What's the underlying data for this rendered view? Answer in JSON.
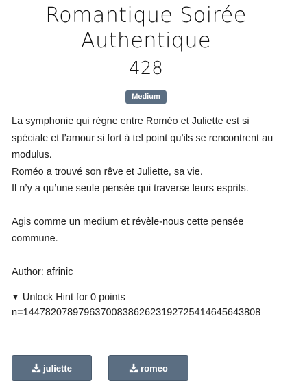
{
  "challenge": {
    "title": "Romantique Soirée Authentique",
    "points": "428",
    "difficulty": "Medium",
    "description_lines": [
      "La symphonie qui règne entre Roméo et Juliette est si spéciale et l’amour si fort à tel point qu’ils se rencontrent au modulus.",
      "Roméo a trouvé son rêve et Juliette, sa vie.",
      "Il n’y a qu’une seule pensée qui traverse leurs esprits.",
      "Agis comme un medium et révèle-nous cette pensée commune."
    ],
    "author": "Author: afrinic",
    "hint": {
      "label": "Unlock Hint for 0 points",
      "content": "n=1447820789796370083862623192725414645643808"
    },
    "files": [
      {
        "label": "juliette",
        "icon": "download-icon"
      },
      {
        "label": "romeo",
        "icon": "download-icon"
      }
    ]
  },
  "colors": {
    "badge_bg": "#5b6e82",
    "button_bg": "#5b6e82",
    "text": "#222222"
  }
}
